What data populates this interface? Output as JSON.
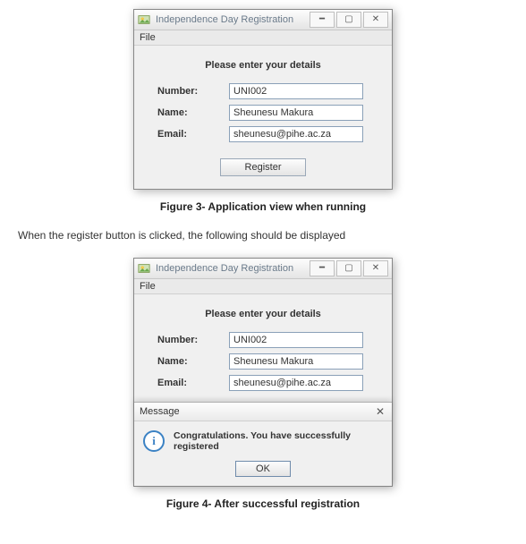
{
  "window1": {
    "title": "Independence Day Registration",
    "menu": {
      "file": "File"
    },
    "heading": "Please enter your details",
    "labels": {
      "number": "Number:",
      "name": "Name:",
      "email": "Email:"
    },
    "values": {
      "number": "UNI002",
      "name": "Sheunesu Makura",
      "email": "sheunesu@pihe.ac.za"
    },
    "register": "Register"
  },
  "caption1": "Figure 3- Application view when running",
  "prose1": "When the register button is clicked, the following should be displayed",
  "window2": {
    "title": "Independence Day Registration",
    "menu": {
      "file": "File"
    },
    "heading": "Please enter your details",
    "labels": {
      "number": "Number:",
      "name": "Name:",
      "email": "Email:"
    },
    "values": {
      "number": "UNI002",
      "name": "Sheunesu Makura",
      "email": "sheunesu@pihe.ac.za"
    },
    "dialog": {
      "title": "Message",
      "message": "Congratulations. You have successfully registered",
      "ok": "OK"
    }
  },
  "caption2": "Figure 4- After successful registration"
}
